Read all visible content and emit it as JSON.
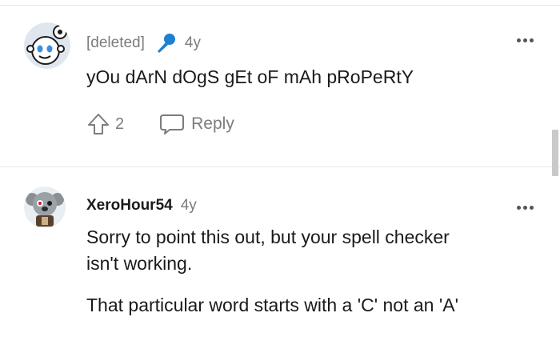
{
  "comments": [
    {
      "username": "[deleted]",
      "age": "4y",
      "flair_icon": "microphone-icon",
      "avatar_icon": "snoo-avatar-icon",
      "body": [
        "yOu dArN dOgS gEt oF mAh pRoPeRtY"
      ],
      "vote_count": "2",
      "reply_label": "Reply"
    },
    {
      "username": "XeroHour54",
      "age": "4y",
      "avatar_icon": "koala-avatar-icon",
      "body": [
        "Sorry to point this out, but your spell checker",
        "isn't working.",
        "That particular word starts with a 'C' not an 'A'"
      ]
    }
  ],
  "colors": {
    "muted_text": "#7c7c7c",
    "flair_blue": "#1f7fd1",
    "divider": "#e4e6e8",
    "scrollbar": "#c9c9c9"
  }
}
